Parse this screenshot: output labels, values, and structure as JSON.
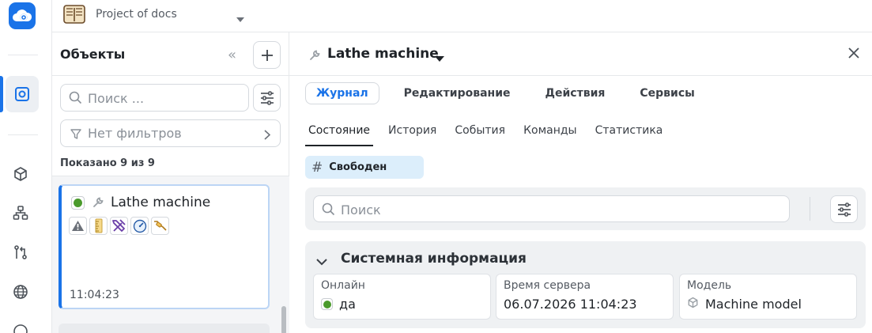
{
  "app": {
    "project_name": "Project of docs",
    "accent": "#1a73e8"
  },
  "rail": {
    "icons": [
      "logo-icon",
      "objects-icon",
      "cube-icon",
      "hierarchy-icon",
      "git-compare-icon",
      "globe-icon",
      "profile-icon"
    ]
  },
  "objects_panel": {
    "title": "Объекты",
    "search_placeholder": "Поиск ...",
    "filter_text": "Нет фильтров",
    "shown_text": "Показано 9 из 9",
    "items": [
      {
        "name": "Lathe machine",
        "status_color": "#4a9a2c",
        "badges": [
          "warning-icon",
          "ruler-icon",
          "tools-icon",
          "gauge-icon",
          "plug-icon"
        ],
        "time": "11:04:23"
      }
    ]
  },
  "details": {
    "title": "Lathe machine",
    "tabs": [
      {
        "label": "Журнал",
        "active": true
      },
      {
        "label": "Редактирование",
        "active": false
      },
      {
        "label": "Действия",
        "active": false
      },
      {
        "label": "Сервисы",
        "active": false
      }
    ],
    "subtabs": [
      {
        "label": "Состояние",
        "active": true
      },
      {
        "label": "История",
        "active": false
      },
      {
        "label": "События",
        "active": false
      },
      {
        "label": "Команды",
        "active": false
      },
      {
        "label": "Статистика",
        "active": false
      }
    ],
    "state_chip": "Свободен",
    "search_placeholder": "Поиск",
    "system_info": {
      "title": "Системная информация",
      "online_label": "Онлайн",
      "online_value": "да",
      "server_time_label": "Время сервера",
      "server_time_value": "06.07.2026 11:04:23",
      "model_label": "Модель",
      "model_value": "Machine model"
    }
  }
}
